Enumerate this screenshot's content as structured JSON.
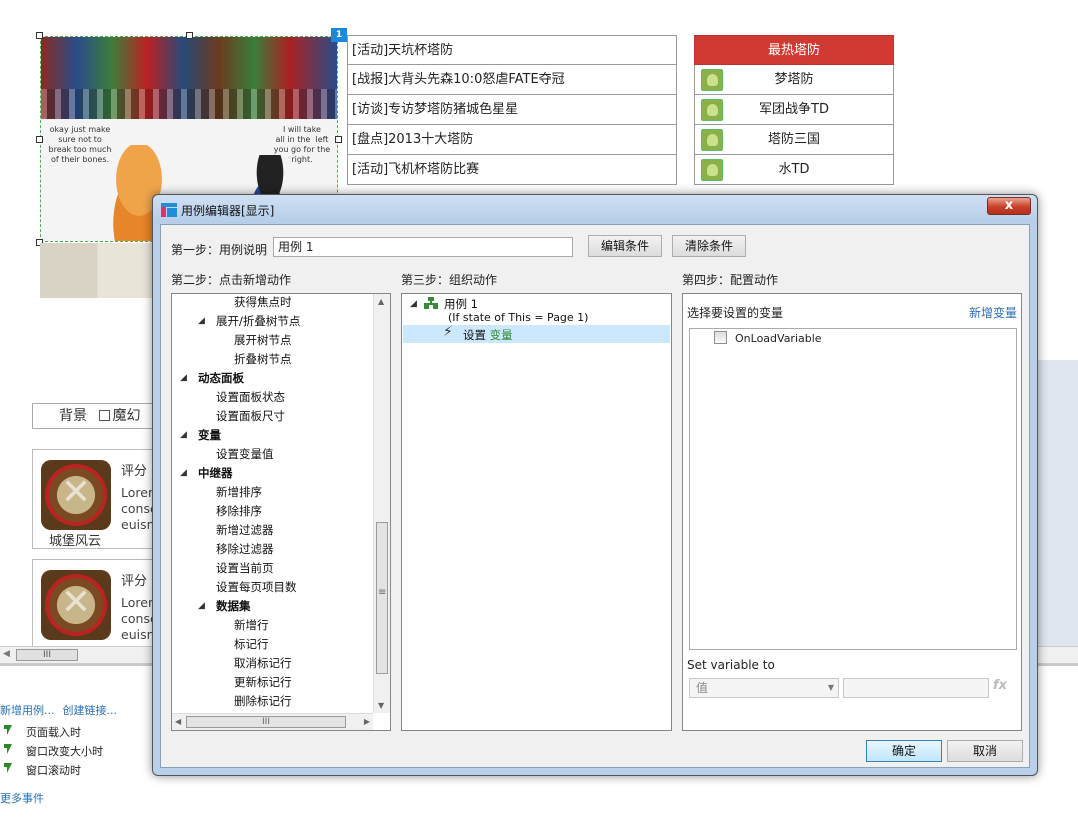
{
  "canvas": {
    "hero": {
      "left_caption": "okay just make\nsure not to\nbreak too much\nof their bones.",
      "right_caption": "I will take\nall in the  left\nyou go for the\nright.",
      "badge": "1"
    },
    "news": [
      "[活动]天坑杯塔防",
      "[战报]大背头先森10:0怒虐FATE夺冠",
      "[访谈]专访梦塔防猪城色星星",
      "[盘点]2013十大塔防",
      "[活动]飞机杯塔防比赛"
    ],
    "hot": {
      "title": "最热塔防",
      "items": [
        "梦塔防",
        "军团战争TD",
        "塔防三国",
        "水TD"
      ]
    },
    "filter": {
      "label": "背景",
      "option": "魔幻"
    },
    "cards": [
      {
        "score": "评分",
        "lorem": "Loren\nconse\neuisn",
        "name": "城堡风云"
      },
      {
        "score": "评分",
        "lorem": "Loren\nconse\neuisn",
        "name": ""
      }
    ],
    "hscroll_thumb": "III"
  },
  "events_panel": {
    "links": [
      "新增用例...",
      "创建链接..."
    ],
    "events": [
      "页面载入时",
      "窗口改变大小时",
      "窗口滚动时"
    ],
    "more": "更多事件"
  },
  "dialog": {
    "title": "用例编辑器[显示]",
    "close": "x",
    "step1": {
      "label": "第一步：用例说明",
      "value": "用例 1",
      "edit_btn": "编辑条件",
      "clear_btn": "清除条件"
    },
    "step2": {
      "label": "第二步：点击新增动作",
      "tree": [
        {
          "text": "获得焦点时",
          "level": 2,
          "bold": false,
          "toggle": ""
        },
        {
          "text": "展开/折叠树节点",
          "level": 1,
          "bold": false,
          "toggle": "◢"
        },
        {
          "text": "展开树节点",
          "level": 2,
          "bold": false,
          "toggle": ""
        },
        {
          "text": "折叠树节点",
          "level": 2,
          "bold": false,
          "toggle": ""
        },
        {
          "text": "动态面板",
          "level": 0,
          "bold": true,
          "toggle": "◢"
        },
        {
          "text": "设置面板状态",
          "level": 1,
          "bold": false,
          "toggle": ""
        },
        {
          "text": "设置面板尺寸",
          "level": 1,
          "bold": false,
          "toggle": ""
        },
        {
          "text": "变量",
          "level": 0,
          "bold": true,
          "toggle": "◢"
        },
        {
          "text": "设置变量值",
          "level": 1,
          "bold": false,
          "toggle": ""
        },
        {
          "text": "中继器",
          "level": 0,
          "bold": true,
          "toggle": "◢"
        },
        {
          "text": "新增排序",
          "level": 1,
          "bold": false,
          "toggle": ""
        },
        {
          "text": "移除排序",
          "level": 1,
          "bold": false,
          "toggle": ""
        },
        {
          "text": "新增过滤器",
          "level": 1,
          "bold": false,
          "toggle": ""
        },
        {
          "text": "移除过滤器",
          "level": 1,
          "bold": false,
          "toggle": ""
        },
        {
          "text": "设置当前页",
          "level": 1,
          "bold": false,
          "toggle": ""
        },
        {
          "text": "设置每页项目数",
          "level": 1,
          "bold": false,
          "toggle": ""
        },
        {
          "text": "数据集",
          "level": 1,
          "bold": true,
          "toggle": "◢"
        },
        {
          "text": "新增行",
          "level": 2,
          "bold": false,
          "toggle": ""
        },
        {
          "text": "标记行",
          "level": 2,
          "bold": false,
          "toggle": ""
        },
        {
          "text": "取消标记行",
          "level": 2,
          "bold": false,
          "toggle": ""
        },
        {
          "text": "更新标记行",
          "level": 2,
          "bold": false,
          "toggle": ""
        },
        {
          "text": "删除标记行",
          "level": 2,
          "bold": false,
          "toggle": ""
        }
      ],
      "hscroll_thumb": "III"
    },
    "step3": {
      "label": "第三步：组织动作",
      "case_name": "用例 1",
      "condition": "(If state of This = Page 1)",
      "action_prefix": "设置",
      "action_target": "变量"
    },
    "step4": {
      "label": "第四步：配置动作",
      "select_var_label": "选择要设置的变量",
      "add_var_link": "新增变量",
      "variables": [
        "OnLoadVariable"
      ],
      "set_to_label": "Set variable to",
      "select_value": "值",
      "fx": "fx"
    },
    "ok_btn": "确定",
    "cancel_btn": "取消"
  }
}
